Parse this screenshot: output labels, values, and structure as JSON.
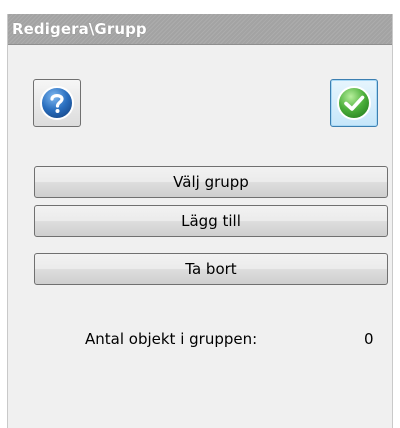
{
  "panel": {
    "title": "Redigera\\Grupp"
  },
  "icons": {
    "help": "help-question-icon",
    "ok": "ok-checkmark-icon"
  },
  "buttons": {
    "select_group": "Välj grupp",
    "add": "Lägg till",
    "remove": "Ta bort"
  },
  "group_count": {
    "label": "Antal objekt i gruppen:",
    "value": "0"
  },
  "colors": {
    "titlebar": "#a3a3a3",
    "help_icon": "#2a6fbf",
    "ok_icon": "#4caf3b"
  }
}
